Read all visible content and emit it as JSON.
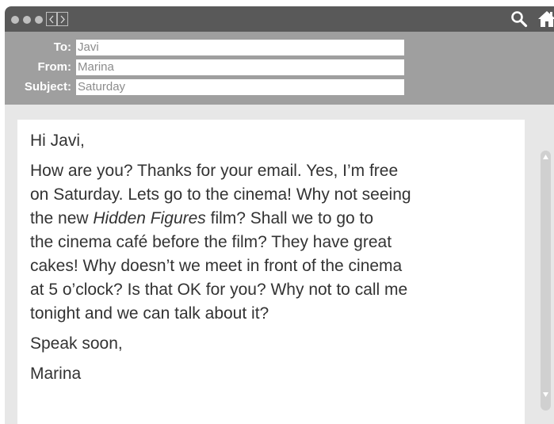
{
  "email": {
    "to_label": "To:",
    "to_value": "Javi",
    "from_label": "From:",
    "from_value": "Marina",
    "subject_label": "Subject:",
    "subject_value": "Saturday"
  },
  "body": {
    "greeting": "Hi Javi,",
    "line1": "How are you? Thanks for your email. Yes, I’m free",
    "line2": "on Saturday. Lets go to the cinema! Why not seeing",
    "line3_before": "the new ",
    "line3_italic": "Hidden Figures",
    "line3_after": " film? Shall we to go to",
    "line4": "the cinema café before the film? They have great",
    "line5": "cakes! Why doesn’t we meet in front of the cinema",
    "line6": "at 5 o’clock? Is that OK for you? Why not to call me",
    "line7": "tonight and we can talk about it?",
    "closing": "Speak soon,",
    "signature": "Marina"
  },
  "icons": {
    "back": "chevron-left-icon",
    "forward": "chevron-right-icon",
    "search": "search-icon",
    "home": "home-icon",
    "scroll_up": "triangle-up-icon",
    "scroll_down": "triangle-down-icon"
  },
  "colors": {
    "titlebar": "#595959",
    "header": "#9f9f9f",
    "window_bg": "#e7e7e7",
    "label_text": "#ffffff",
    "field_text": "#8c8c8c",
    "body_text": "#333333"
  }
}
